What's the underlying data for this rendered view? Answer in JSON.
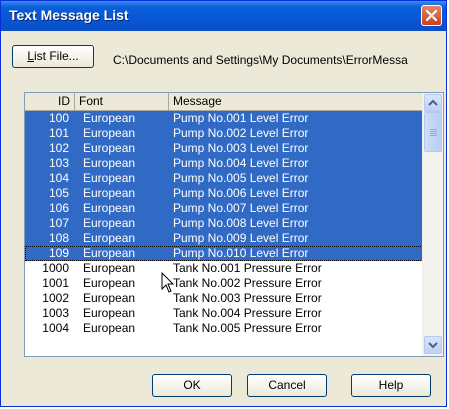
{
  "window": {
    "title": "Text Message List"
  },
  "toolbar": {
    "list_file_label_u": "L",
    "list_file_label_rest": "ist File...",
    "path": "C:\\Documents and Settings\\My Documents\\ErrorMessa"
  },
  "table": {
    "headers": [
      "ID",
      "Font",
      "Message"
    ],
    "rows": [
      {
        "id": "100",
        "font": "European",
        "message": "Pump No.001 Level Error",
        "selected": true
      },
      {
        "id": "101",
        "font": "European",
        "message": "Pump No.002 Level Error",
        "selected": true
      },
      {
        "id": "102",
        "font": "European",
        "message": "Pump No.003 Level Error",
        "selected": true
      },
      {
        "id": "103",
        "font": "European",
        "message": "Pump No.004 Level Error",
        "selected": true
      },
      {
        "id": "104",
        "font": "European",
        "message": "Pump No.005 Level Error",
        "selected": true
      },
      {
        "id": "105",
        "font": "European",
        "message": "Pump No.006 Level Error",
        "selected": true
      },
      {
        "id": "106",
        "font": "European",
        "message": "Pump No.007 Level Error",
        "selected": true
      },
      {
        "id": "107",
        "font": "European",
        "message": "Pump No.008 Level Error",
        "selected": true
      },
      {
        "id": "108",
        "font": "European",
        "message": "Pump No.009 Level Error",
        "selected": true
      },
      {
        "id": "109",
        "font": "European",
        "message": "Pump No.010 Level Error",
        "selected": true,
        "focused": true
      },
      {
        "id": "1000",
        "font": "European",
        "message": "Tank No.001 Pressure Error",
        "selected": false
      },
      {
        "id": "1001",
        "font": "European",
        "message": "Tank No.002 Pressure Error",
        "selected": false
      },
      {
        "id": "1002",
        "font": "European",
        "message": "Tank No.003 Pressure Error",
        "selected": false
      },
      {
        "id": "1003",
        "font": "European",
        "message": "Tank No.004 Pressure Error",
        "selected": false
      },
      {
        "id": "1004",
        "font": "European",
        "message": "Tank No.005 Pressure Error",
        "selected": false
      }
    ]
  },
  "buttons": {
    "ok": "OK",
    "cancel": "Cancel",
    "help": "Help"
  },
  "colors": {
    "selection": "#316ac5",
    "titlebar": "#0756d6",
    "close": "#c9401e"
  },
  "icons": {
    "close": "close-icon",
    "scroll_up": "chevron-up-icon",
    "scroll_down": "chevron-down-icon",
    "cursor": "arrow-cursor-icon"
  }
}
